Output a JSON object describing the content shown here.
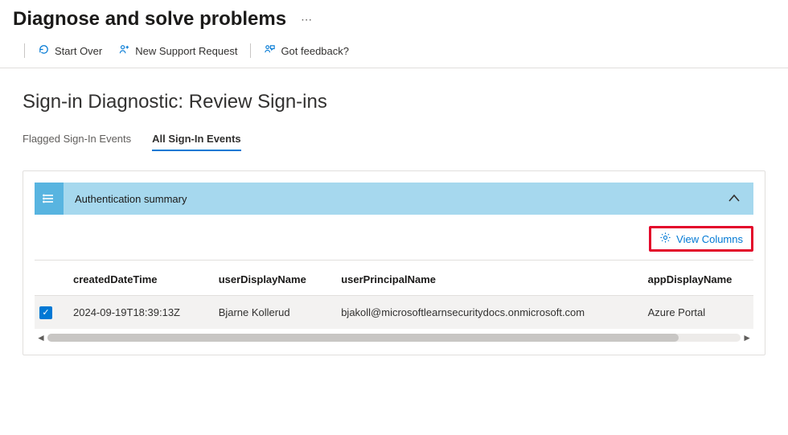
{
  "header": {
    "title": "Diagnose and solve problems"
  },
  "toolbar": {
    "start_over": "Start Over",
    "new_support_request": "New Support Request",
    "got_feedback": "Got feedback?"
  },
  "page": {
    "heading": "Sign-in Diagnostic: Review Sign-ins"
  },
  "tabs": {
    "flagged": "Flagged Sign-In Events",
    "all": "All Sign-In Events",
    "active_index": 1
  },
  "summary": {
    "title": "Authentication summary",
    "expanded": true
  },
  "actions": {
    "view_columns": "View Columns"
  },
  "table": {
    "columns": {
      "createdDateTime": "createdDateTime",
      "userDisplayName": "userDisplayName",
      "userPrincipalName": "userPrincipalName",
      "appDisplayName": "appDisplayName"
    },
    "rows": [
      {
        "checked": true,
        "createdDateTime": "2024-09-19T18:39:13Z",
        "userDisplayName": "Bjarne Kollerud",
        "userPrincipalName": "bjakoll@microsoftlearnsecuritydocs.onmicrosoft.com",
        "appDisplayName": "Azure Portal"
      }
    ]
  }
}
